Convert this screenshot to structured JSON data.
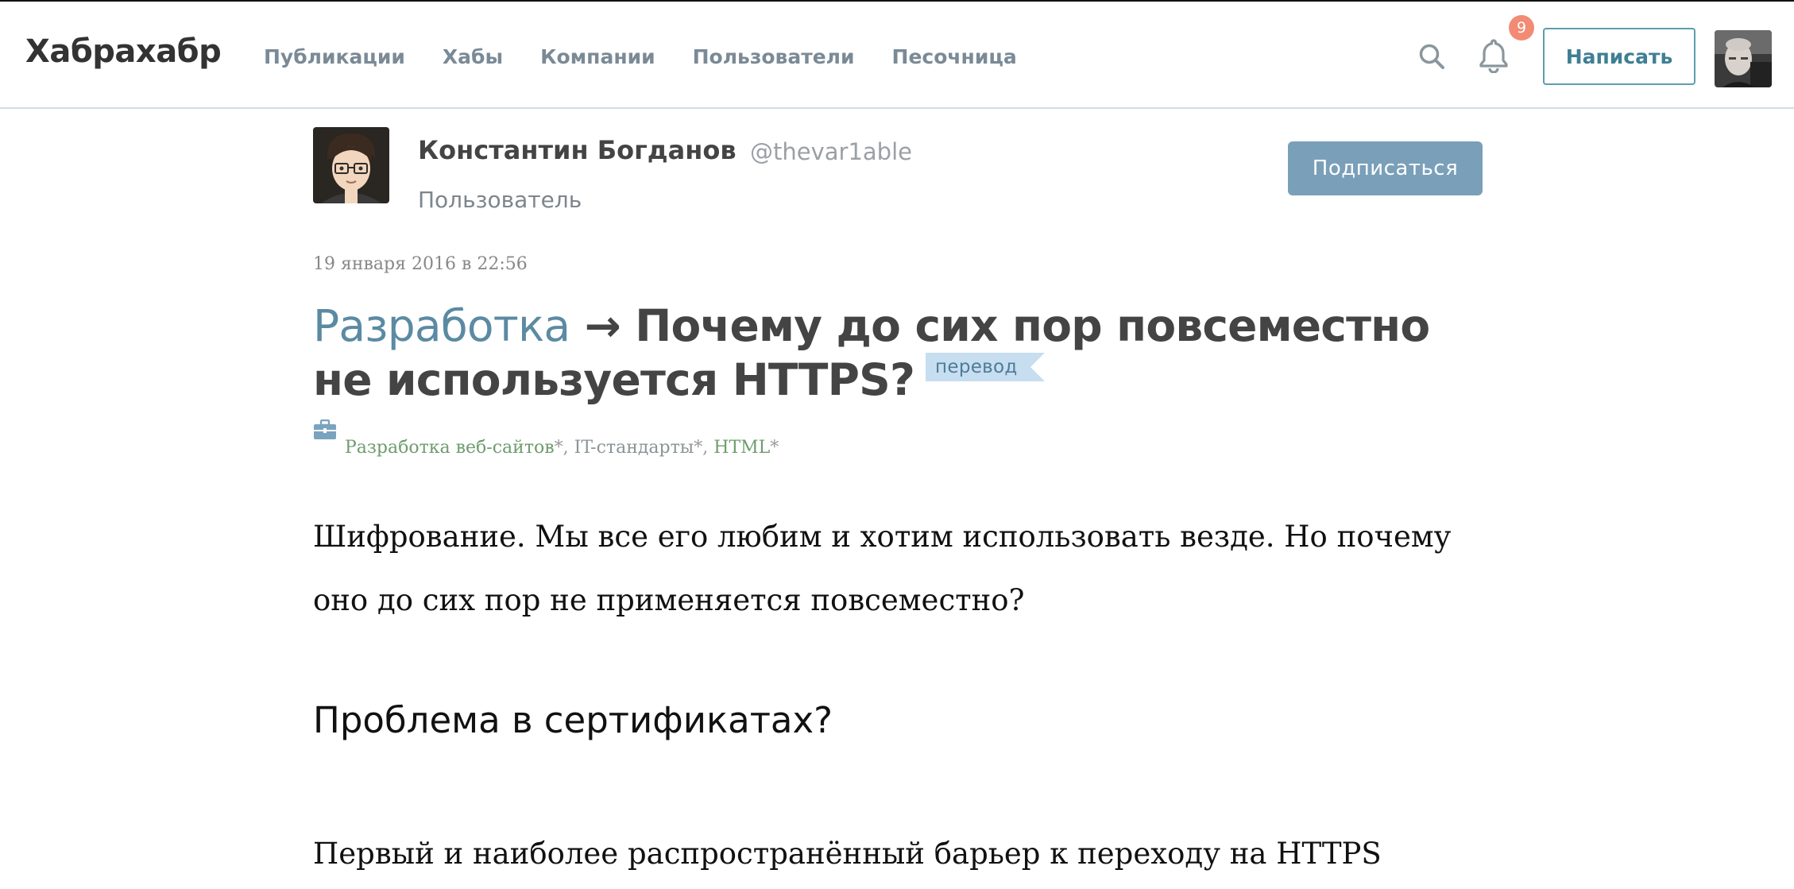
{
  "header": {
    "logo": "Хабрахабр",
    "nav": [
      "Публикации",
      "Хабы",
      "Компании",
      "Пользователи",
      "Песочница"
    ],
    "search_icon": "search-icon",
    "notifications": {
      "icon": "bell-icon",
      "count": "9",
      "badge_color": "#f28b74"
    },
    "write_button": "Написать",
    "user_avatar": "user-avatar"
  },
  "author": {
    "name": "Константин Богданов",
    "handle": "@thevar1able",
    "role": "Пользователь",
    "subscribe_button": "Подписаться"
  },
  "post": {
    "date": "19 января 2016 в 22:56",
    "hub": "Разработка",
    "arrow": "→",
    "title": "Почему до сих пор повсеместно не используется HTTPS?",
    "label": "перевод",
    "hubs_icon": "briefcase-icon",
    "hubs": [
      {
        "name": "Разработка веб-сайтов",
        "suffix": "*",
        "sep": ", "
      },
      {
        "name": "IT-стандарты",
        "suffix": "*",
        "sep": ", "
      },
      {
        "name": "HTML",
        "suffix": "*",
        "sep": ""
      }
    ],
    "body": {
      "paragraph1": "Шифрование. Мы все его любим и хотим использовать везде. Но почему оно до сих пор не применяется повсеместно?",
      "heading": "Проблема в сертификатах?",
      "paragraph2": "Первый и наиболее распространённый барьер к переходу на HTTPS"
    }
  },
  "colors": {
    "accent": "#5b8aa3",
    "write_border": "#5d9db0",
    "subscribe_bg": "#7a9fb9",
    "label_bg": "#c6def0",
    "hub_profiled": "#6e9c6e"
  }
}
